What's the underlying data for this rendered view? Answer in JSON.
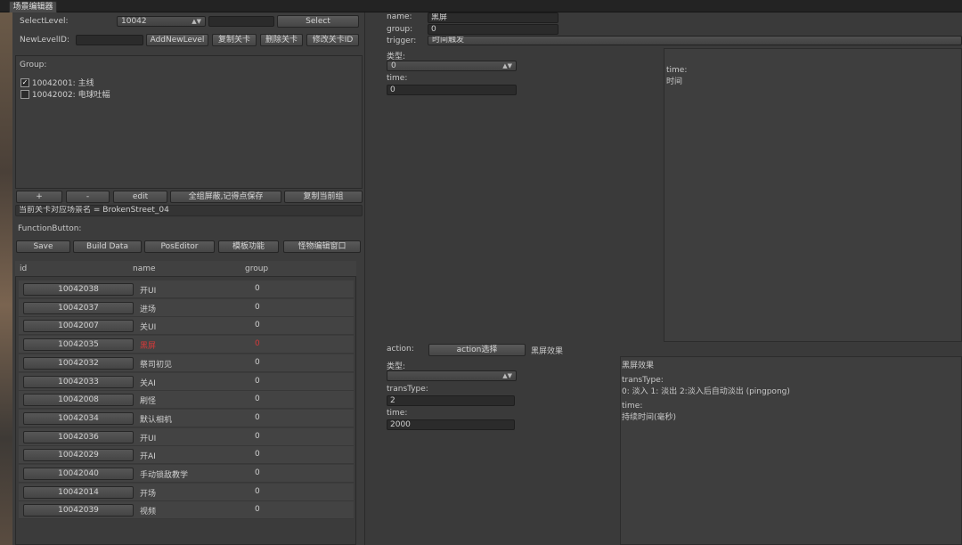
{
  "window": {
    "tab_title": "场景编辑器"
  },
  "top": {
    "select_level_label": "SelectLevel:",
    "select_level_value": "10042",
    "select_level_input": "",
    "select_button": "Select",
    "new_level_label": "NewLevelID:",
    "new_level_input": "",
    "add_new_level": "AddNewLevel",
    "copy_level": "复制关卡",
    "delete_level": "删除关卡",
    "modify_level_id": "修改关卡ID"
  },
  "group": {
    "label": "Group:",
    "items": [
      {
        "text": "10042001: 主线",
        "checked": true
      },
      {
        "text": "10042002: 电球吐幅",
        "checked": false
      }
    ],
    "buttons": {
      "plus": "+",
      "minus": "-",
      "edit": "edit",
      "shield_all": "全组屏蔽,记得点保存",
      "copy_group": "复制当前组"
    },
    "scene_name": "当前关卡对应场景名 = BrokenStreet_04"
  },
  "function": {
    "label": "FunctionButton:",
    "buttons": {
      "save": "Save",
      "build": "Build Data",
      "pos_editor": "PosEditor",
      "template": "模板功能",
      "monster": "怪物编辑窗口"
    }
  },
  "table": {
    "headers": {
      "id": "id",
      "name": "name",
      "group": "group"
    },
    "rows": [
      {
        "id": "10042038",
        "name": "开UI",
        "group": "0"
      },
      {
        "id": "10042037",
        "name": "进场",
        "group": "0"
      },
      {
        "id": "10042007",
        "name": "关UI",
        "group": "0"
      },
      {
        "id": "10042035",
        "name": "黑屏",
        "group": "0",
        "highlight": true
      },
      {
        "id": "10042032",
        "name": "祭司初见",
        "group": "0"
      },
      {
        "id": "10042033",
        "name": "关AI",
        "group": "0"
      },
      {
        "id": "10042008",
        "name": "刷怪",
        "group": "0"
      },
      {
        "id": "10042034",
        "name": "默认相机",
        "group": "0"
      },
      {
        "id": "10042036",
        "name": "开UI",
        "group": "0"
      },
      {
        "id": "10042029",
        "name": "开AI",
        "group": "0"
      },
      {
        "id": "10042040",
        "name": "手动锁敌教学",
        "group": "0"
      },
      {
        "id": "10042014",
        "name": "开场",
        "group": "0"
      },
      {
        "id": "10042039",
        "name": "视频",
        "group": "0"
      }
    ],
    "highlight_color": "#d23a3a"
  },
  "detail": {
    "name_label": "name:",
    "name_value": "黑屏",
    "group_label": "group:",
    "group_value": "0",
    "trigger_label": "trigger:",
    "trigger_value": "时间触发",
    "trigger_type_label": "类型:",
    "trigger_type_value": "0",
    "time_label": "time:",
    "time_value": "0",
    "trigger_help_key": "time:",
    "trigger_help_desc": "时间",
    "action_label": "action:",
    "action_button": "action选择",
    "action_value": "黑屏效果",
    "action_type_label": "类型:",
    "action_type_value": "",
    "trans_type_label": "transType:",
    "trans_type_value": "2",
    "action_time_label": "time:",
    "action_time_value": "2000",
    "action_help": {
      "title": "黑屏效果",
      "trans_key": "transType:",
      "trans_desc": "0: 淡入   1: 淡出   2:淡入后自动淡出 (pingpong)",
      "time_key": "time:",
      "time_desc": "持续时间(毫秒)"
    }
  }
}
